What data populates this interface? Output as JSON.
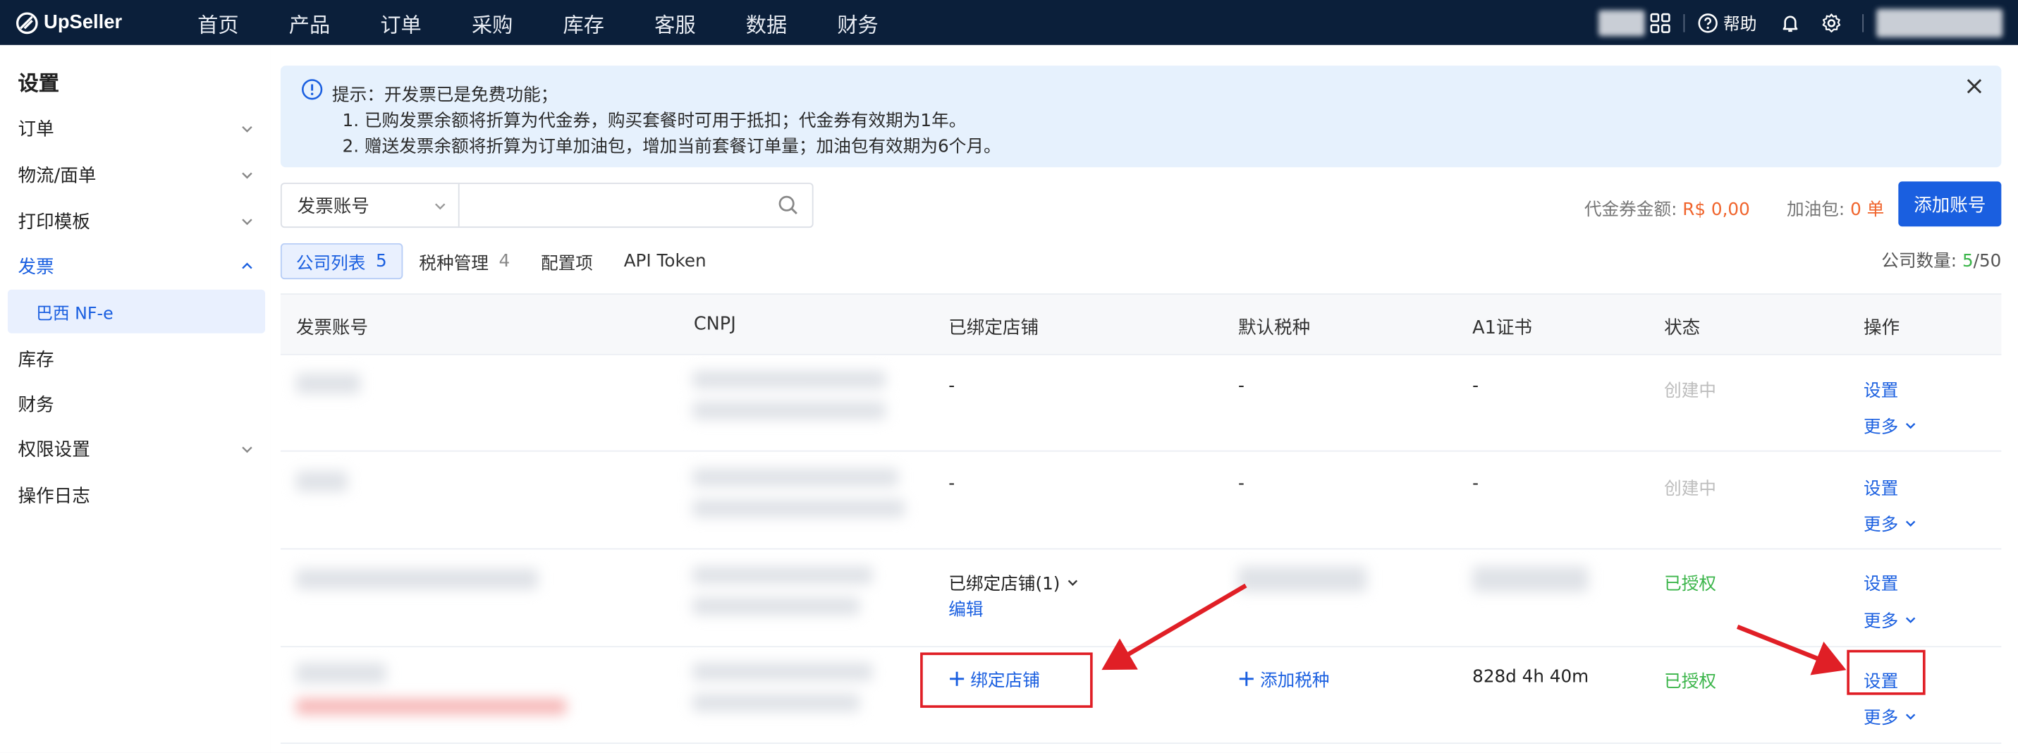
{
  "app": {
    "logo_text": "UpSeller"
  },
  "nav": [
    "首页",
    "产品",
    "订单",
    "采购",
    "库存",
    "客服",
    "数据",
    "财务"
  ],
  "header": {
    "help_label": "帮助"
  },
  "sidebar": {
    "title": "设置",
    "items": [
      {
        "label": "订单",
        "expandable": true
      },
      {
        "label": "物流/面单",
        "expandable": true
      },
      {
        "label": "打印模板",
        "expandable": true
      },
      {
        "label": "发票",
        "expandable": true,
        "expanded": true,
        "active": true
      },
      {
        "label": "库存",
        "expandable": false
      },
      {
        "label": "财务",
        "expandable": false
      },
      {
        "label": "权限设置",
        "expandable": true
      },
      {
        "label": "操作日志",
        "expandable": false
      }
    ],
    "sub_item": "巴西 NF-e"
  },
  "notice": {
    "line1": "提示：开发票已是免费功能；",
    "line2": "1. 已购发票余额将折算为代金券，购买套餐时可用于抵扣；代金券有效期为1年。",
    "line3": "2. 赠送发票余额将折算为订单加油包，增加当前套餐订单量；加油包有效期为6个月。"
  },
  "search": {
    "select_value": "发票账号",
    "input_value": "",
    "input_placeholder": ""
  },
  "stats": {
    "voucher_label": "代金券金额:",
    "voucher_value": "R$ 0,00",
    "fuel_label": "加油包:",
    "fuel_value": "0 单"
  },
  "add_button": "添加账号",
  "tabs": [
    {
      "label": "公司列表",
      "count": "5",
      "active": true
    },
    {
      "label": "税种管理",
      "count": "4",
      "active": false
    },
    {
      "label": "配置项",
      "count": "",
      "active": false
    },
    {
      "label": "API Token",
      "count": "",
      "active": false
    }
  ],
  "company_count": {
    "label": "公司数量:",
    "current": "5",
    "total": "/50"
  },
  "table": {
    "columns": [
      "发票账号",
      "CNPJ",
      "已绑定店铺",
      "默认税种",
      "A1证书",
      "状态",
      "操作"
    ],
    "rows": [
      {
        "shop": "-",
        "tax": "-",
        "cert": "-",
        "status": "创建中",
        "action": "设置",
        "more": "更多"
      },
      {
        "shop": "-",
        "tax": "-",
        "cert": "-",
        "status": "创建中",
        "action": "设置",
        "more": "更多"
      },
      {
        "shop": "已绑定店铺(1)",
        "shop_edit": "编辑",
        "status": "已授权",
        "action": "设置",
        "more": "更多"
      },
      {
        "shop": "绑定店铺",
        "tax": "添加税种",
        "cert": "828d 4h 40m",
        "status": "已授权",
        "action": "设置",
        "more": "更多"
      }
    ]
  },
  "colors": {
    "nav_bg": "#0b1f3a",
    "primary": "#1a5fe0",
    "success": "#3bb54a",
    "warning": "#f0642c",
    "annotation": "#e01f26"
  }
}
